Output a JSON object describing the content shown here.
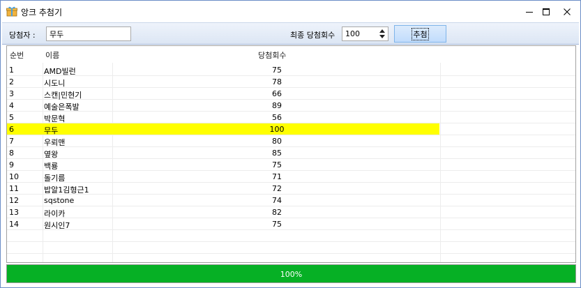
{
  "window": {
    "title": "앙크 추첨기"
  },
  "toolbar": {
    "winner_label": "당첨자 :",
    "winner_value": "무두",
    "count_label": "최종 당첨회수",
    "count_value": "100",
    "draw_button": "추첨"
  },
  "grid": {
    "headers": {
      "no": "순번",
      "name": "이름",
      "count": "당첨회수"
    },
    "rows": [
      {
        "no": "1",
        "name": "AMD빌런",
        "count": "75"
      },
      {
        "no": "2",
        "name": "시도니",
        "count": "78"
      },
      {
        "no": "3",
        "name": "스캔|민현기",
        "count": "66"
      },
      {
        "no": "4",
        "name": "예술은폭발",
        "count": "89"
      },
      {
        "no": "5",
        "name": "박문혁",
        "count": "56"
      },
      {
        "no": "6",
        "name": "무두",
        "count": "100"
      },
      {
        "no": "7",
        "name": "우뢰맨",
        "count": "80"
      },
      {
        "no": "8",
        "name": "옆왕",
        "count": "85"
      },
      {
        "no": "9",
        "name": "백룡",
        "count": "75"
      },
      {
        "no": "10",
        "name": "돌기름",
        "count": "71"
      },
      {
        "no": "11",
        "name": "밥알1김형근1",
        "count": "72"
      },
      {
        "no": "12",
        "name": "sqstone",
        "count": "74"
      },
      {
        "no": "13",
        "name": "라이카",
        "count": "82"
      },
      {
        "no": "14",
        "name": "원시인7",
        "count": "75"
      }
    ],
    "selected_row": 6
  },
  "progress": {
    "value": 1.0,
    "label": "100%",
    "color": "#06b025"
  },
  "colors": {
    "highlight": "#ffff00",
    "accent": "#7eb4ea"
  },
  "icons": {
    "app": "gift-icon",
    "minimize": "minimize-icon",
    "maximize": "maximize-icon",
    "close": "close-icon"
  }
}
